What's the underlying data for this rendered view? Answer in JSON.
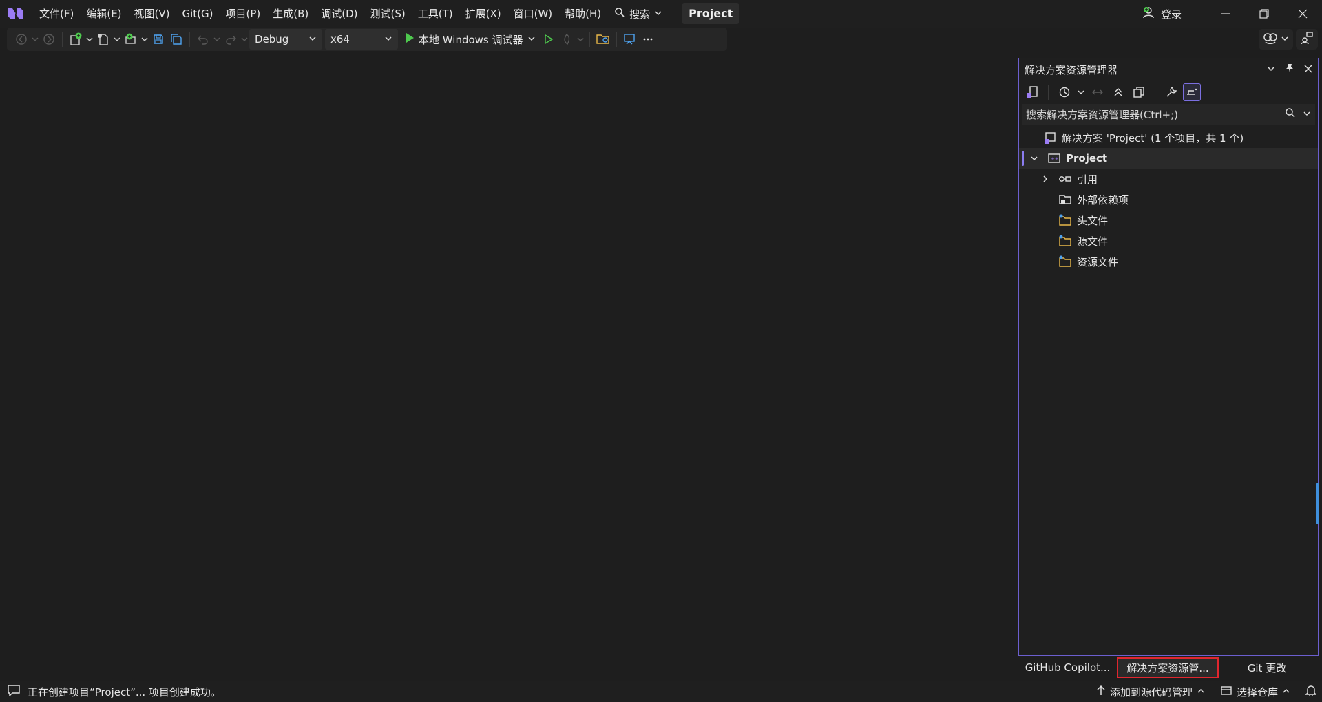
{
  "titlebar": {
    "menu": [
      "文件(F)",
      "编辑(E)",
      "视图(V)",
      "Git(G)",
      "项目(P)",
      "生成(B)",
      "调试(D)",
      "测试(S)",
      "工具(T)",
      "扩展(X)",
      "窗口(W)",
      "帮助(H)"
    ],
    "search_label": "搜索",
    "project_name": "Project",
    "login_label": "登录"
  },
  "toolbar": {
    "configuration": "Debug",
    "platform": "x64",
    "run_label": "本地 Windows 调试器"
  },
  "solution_explorer": {
    "title": "解决方案资源管理器",
    "search_placeholder": "搜索解决方案资源管理器(Ctrl+;)",
    "solution_label": "解决方案 'Project' (1 个项目，共 1 个)",
    "project_label": "Project",
    "items": [
      "引用",
      "外部依赖项",
      "头文件",
      "源文件",
      "资源文件"
    ]
  },
  "bottom_tabs": [
    "GitHub Copilot...",
    "解决方案资源管...",
    "Git 更改"
  ],
  "statusbar": {
    "message": "正在创建项目“Project”... 项目创建成功。",
    "source_control": "添加到源代码管理",
    "repository": "选择仓库"
  },
  "colors": {
    "accent": "#8b7cf0",
    "run_green": "#4ec94e",
    "highlight_red": "#e0262e"
  }
}
